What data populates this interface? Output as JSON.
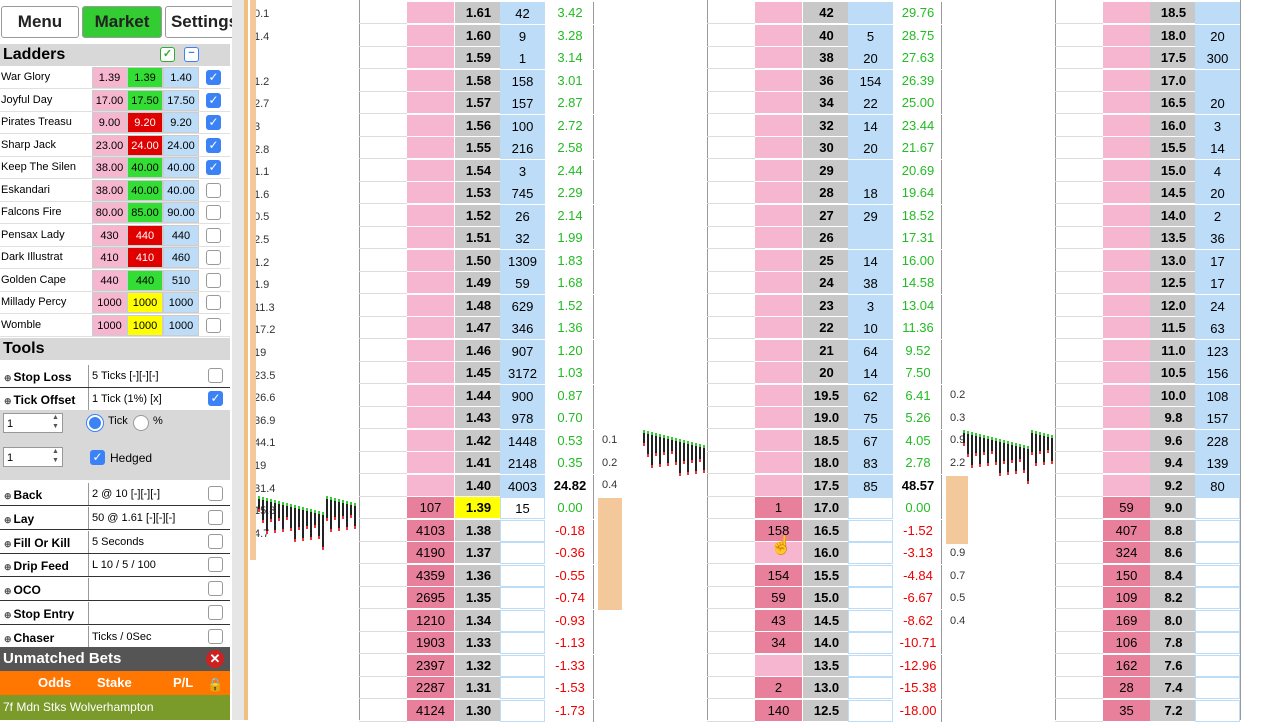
{
  "menu": {
    "menu_label": "Menu",
    "market_label": "Market",
    "settings_label": "Settings"
  },
  "ladders_header": "Ladders",
  "runners": [
    {
      "name": "War Glory",
      "back": "1.39",
      "mid": "1.39",
      "lay": "1.40",
      "mid_color": "#33dd33",
      "checked": true
    },
    {
      "name": "Joyful Day",
      "back": "17.00",
      "mid": "17.50",
      "lay": "17.50",
      "mid_color": "#33dd33",
      "checked": true
    },
    {
      "name": "Pirates Treasu",
      "back": "9.00",
      "mid": "9.20",
      "lay": "9.20",
      "mid_color": "#e00000",
      "checked": true
    },
    {
      "name": "Sharp Jack",
      "back": "23.00",
      "mid": "24.00",
      "lay": "24.00",
      "mid_color": "#e00000",
      "checked": true
    },
    {
      "name": "Keep The Silen",
      "back": "38.00",
      "mid": "40.00",
      "lay": "40.00",
      "mid_color": "#33dd33",
      "checked": true
    },
    {
      "name": "Eskandari",
      "back": "38.00",
      "mid": "40.00",
      "lay": "40.00",
      "mid_color": "#33dd33",
      "checked": false
    },
    {
      "name": "Falcons Fire",
      "back": "80.00",
      "mid": "85.00",
      "lay": "90.00",
      "mid_color": "#33dd33",
      "checked": false
    },
    {
      "name": "Pensax Lady",
      "back": "430",
      "mid": "440",
      "lay": "440",
      "mid_color": "#e00000",
      "checked": false
    },
    {
      "name": "Dark Illustrat",
      "back": "410",
      "mid": "410",
      "lay": "460",
      "mid_color": "#e00000",
      "checked": false
    },
    {
      "name": "Golden Cape",
      "back": "440",
      "mid": "440",
      "lay": "510",
      "mid_color": "#33dd33",
      "checked": false
    },
    {
      "name": "Millady Percy",
      "back": "1000",
      "mid": "1000",
      "lay": "1000",
      "mid_color": "#ffff00",
      "checked": false
    },
    {
      "name": "Womble",
      "back": "1000",
      "mid": "1000",
      "lay": "1000",
      "mid_color": "#ffff00",
      "checked": false
    }
  ],
  "tools_header": "Tools",
  "tools": [
    {
      "name": "Stop Loss",
      "value": "5 Ticks [-][-][-]",
      "checked": false
    },
    {
      "name": "Tick Offset",
      "value": "1 Tick (1%) [x]",
      "checked": true
    }
  ],
  "offset": {
    "value1": "1",
    "tick_label": "Tick",
    "pct_label": "%",
    "value2": "1",
    "hedged_label": "Hedged"
  },
  "tools2": [
    {
      "name": "Back",
      "value": "2 @ 10 [-][-][-]"
    },
    {
      "name": "Lay",
      "value": "50 @ 1.61 [-][-][-]"
    },
    {
      "name": "Fill Or Kill",
      "value": "5 Seconds"
    },
    {
      "name": "Drip Feed",
      "value": "L 10 / 5 / 100"
    },
    {
      "name": "OCO",
      "value": ""
    },
    {
      "name": "Stop Entry",
      "value": ""
    },
    {
      "name": "Chaser",
      "value": "Ticks / 0Sec"
    }
  ],
  "unmatched": {
    "title": "Unmatched Bets",
    "odds": "Odds",
    "stake": "Stake",
    "pl": "P/L",
    "race": "7f Mdn Stks Wolverhampton"
  },
  "side1": [
    "0.1",
    "1.4",
    "",
    "1.2",
    "2.7",
    "3",
    "2.8",
    "1.1",
    "1.6",
    "0.5",
    "2.5",
    "1.2",
    "1.9",
    "11.3",
    "17.2",
    "19",
    "23.5",
    "26.6",
    "36.9",
    "44.1",
    "19",
    "31.4",
    "15.8",
    "4.7"
  ],
  "ladder1": [
    {
      "back": "",
      "price": "1.61",
      "lay": "42",
      "pl": "3.42"
    },
    {
      "back": "",
      "price": "1.60",
      "lay": "9",
      "pl": "3.28"
    },
    {
      "back": "",
      "price": "1.59",
      "lay": "1",
      "pl": "3.14"
    },
    {
      "back": "",
      "price": "1.58",
      "lay": "158",
      "pl": "3.01"
    },
    {
      "back": "",
      "price": "1.57",
      "lay": "157",
      "pl": "2.87"
    },
    {
      "back": "",
      "price": "1.56",
      "lay": "100",
      "pl": "2.72"
    },
    {
      "back": "",
      "price": "1.55",
      "lay": "216",
      "pl": "2.58"
    },
    {
      "back": "",
      "price": "1.54",
      "lay": "3",
      "pl": "2.44"
    },
    {
      "back": "",
      "price": "1.53",
      "lay": "745",
      "pl": "2.29"
    },
    {
      "back": "",
      "price": "1.52",
      "lay": "26",
      "pl": "2.14"
    },
    {
      "back": "",
      "price": "1.51",
      "lay": "32",
      "pl": "1.99"
    },
    {
      "back": "",
      "price": "1.50",
      "lay": "1309",
      "pl": "1.83"
    },
    {
      "back": "",
      "price": "1.49",
      "lay": "59",
      "pl": "1.68"
    },
    {
      "back": "",
      "price": "1.48",
      "lay": "629",
      "pl": "1.52"
    },
    {
      "back": "",
      "price": "1.47",
      "lay": "346",
      "pl": "1.36"
    },
    {
      "back": "",
      "price": "1.46",
      "lay": "907",
      "pl": "1.20"
    },
    {
      "back": "",
      "price": "1.45",
      "lay": "3172",
      "pl": "1.03"
    },
    {
      "back": "",
      "price": "1.44",
      "lay": "900",
      "pl": "0.87"
    },
    {
      "back": "",
      "price": "1.43",
      "lay": "978",
      "pl": "0.70"
    },
    {
      "back": "",
      "price": "1.42",
      "lay": "1448",
      "pl": "0.53"
    },
    {
      "back": "",
      "price": "1.41",
      "lay": "2148",
      "pl": "0.35"
    },
    {
      "back": "",
      "price": "1.40",
      "lay": "4003",
      "pl": "24.82"
    },
    {
      "back": "107",
      "price": "1.39",
      "lay": "15",
      "pl": "0.00"
    },
    {
      "back": "4103",
      "price": "1.38",
      "lay": "",
      "pl": "-0.18"
    },
    {
      "back": "4190",
      "price": "1.37",
      "lay": "",
      "pl": "-0.36"
    },
    {
      "back": "4359",
      "price": "1.36",
      "lay": "",
      "pl": "-0.55"
    },
    {
      "back": "2695",
      "price": "1.35",
      "lay": "",
      "pl": "-0.74"
    },
    {
      "back": "1210",
      "price": "1.34",
      "lay": "",
      "pl": "-0.93"
    },
    {
      "back": "1903",
      "price": "1.33",
      "lay": "",
      "pl": "-1.13"
    },
    {
      "back": "2397",
      "price": "1.32",
      "lay": "",
      "pl": "-1.33"
    },
    {
      "back": "2287",
      "price": "1.31",
      "lay": "",
      "pl": "-1.53"
    },
    {
      "back": "4124",
      "price": "1.30",
      "lay": "",
      "pl": "-1.73"
    }
  ],
  "side2": [
    "0.1",
    "0.2",
    "0.4",
    "0.9",
    "0.9",
    "0.4",
    "0.4",
    "0.2"
  ],
  "ladder2": [
    {
      "back": "",
      "price": "42",
      "lay": "",
      "pl": "29.76"
    },
    {
      "back": "",
      "price": "40",
      "lay": "5",
      "pl": "28.75"
    },
    {
      "back": "",
      "price": "38",
      "lay": "20",
      "pl": "27.63"
    },
    {
      "back": "",
      "price": "36",
      "lay": "154",
      "pl": "26.39"
    },
    {
      "back": "",
      "price": "34",
      "lay": "22",
      "pl": "25.00"
    },
    {
      "back": "",
      "price": "32",
      "lay": "14",
      "pl": "23.44"
    },
    {
      "back": "",
      "price": "30",
      "lay": "20",
      "pl": "21.67"
    },
    {
      "back": "",
      "price": "29",
      "lay": "",
      "pl": "20.69"
    },
    {
      "back": "",
      "price": "28",
      "lay": "18",
      "pl": "19.64"
    },
    {
      "back": "",
      "price": "27",
      "lay": "29",
      "pl": "18.52"
    },
    {
      "back": "",
      "price": "26",
      "lay": "",
      "pl": "17.31"
    },
    {
      "back": "",
      "price": "25",
      "lay": "14",
      "pl": "16.00"
    },
    {
      "back": "",
      "price": "24",
      "lay": "38",
      "pl": "14.58"
    },
    {
      "back": "",
      "price": "23",
      "lay": "3",
      "pl": "13.04"
    },
    {
      "back": "",
      "price": "22",
      "lay": "10",
      "pl": "11.36"
    },
    {
      "back": "",
      "price": "21",
      "lay": "64",
      "pl": "9.52"
    },
    {
      "back": "",
      "price": "20",
      "lay": "14",
      "pl": "7.50"
    },
    {
      "back": "",
      "price": "19.5",
      "lay": "62",
      "pl": "6.41"
    },
    {
      "back": "",
      "price": "19.0",
      "lay": "75",
      "pl": "5.26"
    },
    {
      "back": "",
      "price": "18.5",
      "lay": "67",
      "pl": "4.05"
    },
    {
      "back": "",
      "price": "18.0",
      "lay": "83",
      "pl": "2.78"
    },
    {
      "back": "",
      "price": "17.5",
      "lay": "85",
      "pl": "48.57"
    },
    {
      "back": "1",
      "price": "17.0",
      "lay": "",
      "pl": "0.00"
    },
    {
      "back": "158",
      "price": "16.5",
      "lay": "",
      "pl": "-1.52"
    },
    {
      "back": "",
      "price": "16.0",
      "lay": "",
      "pl": "-3.13"
    },
    {
      "back": "154",
      "price": "15.5",
      "lay": "",
      "pl": "-4.84"
    },
    {
      "back": "59",
      "price": "15.0",
      "lay": "",
      "pl": "-6.67"
    },
    {
      "back": "43",
      "price": "14.5",
      "lay": "",
      "pl": "-8.62"
    },
    {
      "back": "34",
      "price": "14.0",
      "lay": "",
      "pl": "-10.71"
    },
    {
      "back": "",
      "price": "13.5",
      "lay": "",
      "pl": "-12.96"
    },
    {
      "back": "2",
      "price": "13.0",
      "lay": "",
      "pl": "-15.38"
    },
    {
      "back": "140",
      "price": "12.5",
      "lay": "",
      "pl": "-18.00"
    }
  ],
  "side3": [
    "0.2",
    "0.3",
    "0.9",
    "2.2",
    "2.9",
    "2.8",
    "1.2",
    "0.9",
    "0.7",
    "0.5",
    "0.4"
  ],
  "ladder3": [
    {
      "back": "",
      "price": "18.5",
      "lay": ""
    },
    {
      "back": "",
      "price": "18.0",
      "lay": "20"
    },
    {
      "back": "",
      "price": "17.5",
      "lay": "300"
    },
    {
      "back": "",
      "price": "17.0",
      "lay": ""
    },
    {
      "back": "",
      "price": "16.5",
      "lay": "20"
    },
    {
      "back": "",
      "price": "16.0",
      "lay": "3"
    },
    {
      "back": "",
      "price": "15.5",
      "lay": "14"
    },
    {
      "back": "",
      "price": "15.0",
      "lay": "4"
    },
    {
      "back": "",
      "price": "14.5",
      "lay": "20"
    },
    {
      "back": "",
      "price": "14.0",
      "lay": "2"
    },
    {
      "back": "",
      "price": "13.5",
      "lay": "36"
    },
    {
      "back": "",
      "price": "13.0",
      "lay": "17"
    },
    {
      "back": "",
      "price": "12.5",
      "lay": "17"
    },
    {
      "back": "",
      "price": "12.0",
      "lay": "24"
    },
    {
      "back": "",
      "price": "11.5",
      "lay": "63"
    },
    {
      "back": "",
      "price": "11.0",
      "lay": "123"
    },
    {
      "back": "",
      "price": "10.5",
      "lay": "156"
    },
    {
      "back": "",
      "price": "10.0",
      "lay": "108"
    },
    {
      "back": "",
      "price": "9.8",
      "lay": "157"
    },
    {
      "back": "",
      "price": "9.6",
      "lay": "228"
    },
    {
      "back": "",
      "price": "9.4",
      "lay": "139"
    },
    {
      "back": "",
      "price": "9.2",
      "lay": "80"
    },
    {
      "back": "59",
      "price": "9.0",
      "lay": ""
    },
    {
      "back": "407",
      "price": "8.8",
      "lay": ""
    },
    {
      "back": "324",
      "price": "8.6",
      "lay": ""
    },
    {
      "back": "150",
      "price": "8.4",
      "lay": ""
    },
    {
      "back": "109",
      "price": "8.2",
      "lay": ""
    },
    {
      "back": "169",
      "price": "8.0",
      "lay": ""
    },
    {
      "back": "106",
      "price": "7.8",
      "lay": ""
    },
    {
      "back": "162",
      "price": "7.6",
      "lay": ""
    },
    {
      "back": "28",
      "price": "7.4",
      "lay": ""
    },
    {
      "back": "35",
      "price": "7.2",
      "lay": ""
    }
  ]
}
